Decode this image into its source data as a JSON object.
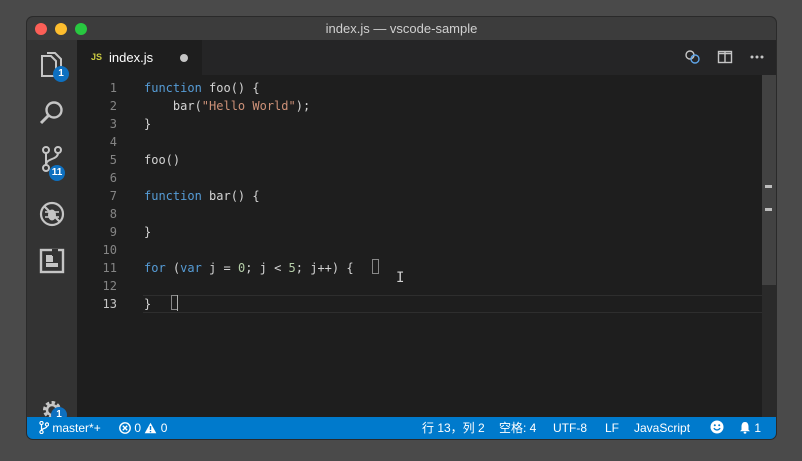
{
  "window": {
    "title": "index.js — vscode-sample"
  },
  "activity_bar": {
    "items": [
      {
        "icon": "files-icon",
        "badge": "1"
      },
      {
        "icon": "search-icon",
        "badge": ""
      },
      {
        "icon": "source-control-icon",
        "badge": "11"
      },
      {
        "icon": "debug-icon",
        "badge": ""
      },
      {
        "icon": "extensions-icon",
        "badge": ""
      }
    ],
    "settings": {
      "icon": "gear-icon",
      "badge": "1"
    }
  },
  "tab": {
    "icon_text": "JS",
    "label": "index.js",
    "dirty": true
  },
  "editor_actions": [
    "open-changes-icon",
    "split-editor-icon",
    "more-actions-icon"
  ],
  "code": {
    "lines": [
      {
        "n": "1",
        "parts": [
          [
            "kw",
            "function"
          ],
          [
            "txt",
            " foo() {"
          ]
        ]
      },
      {
        "n": "2",
        "parts": [
          [
            "txt",
            "    bar("
          ],
          [
            "str",
            "\"Hello World\""
          ],
          [
            "txt",
            ");"
          ]
        ]
      },
      {
        "n": "3",
        "parts": [
          [
            "txt",
            "}"
          ]
        ]
      },
      {
        "n": "4",
        "parts": []
      },
      {
        "n": "5",
        "parts": [
          [
            "txt",
            "foo()"
          ]
        ]
      },
      {
        "n": "6",
        "parts": []
      },
      {
        "n": "7",
        "parts": [
          [
            "kw",
            "function"
          ],
          [
            "txt",
            " bar() {"
          ]
        ]
      },
      {
        "n": "8",
        "parts": []
      },
      {
        "n": "9",
        "parts": [
          [
            "txt",
            "}"
          ]
        ]
      },
      {
        "n": "10",
        "parts": []
      },
      {
        "n": "11",
        "parts": [
          [
            "kw",
            "for"
          ],
          [
            "txt",
            " ("
          ],
          [
            "kw",
            "var"
          ],
          [
            "txt",
            " j = "
          ],
          [
            "num",
            "0"
          ],
          [
            "txt",
            "; j < "
          ],
          [
            "num",
            "5"
          ],
          [
            "txt",
            "; j++) {"
          ]
        ]
      },
      {
        "n": "12",
        "parts": []
      },
      {
        "n": "13",
        "parts": [
          [
            "txt",
            "}"
          ]
        ]
      }
    ],
    "active_line": "13"
  },
  "status_bar": {
    "branch": "master*+",
    "errors": "0",
    "warnings": "0",
    "cursor_position": "行 13，列 2",
    "indentation": "空格: 4",
    "encoding": "UTF-8",
    "eol": "LF",
    "language": "JavaScript",
    "notifications": "1"
  },
  "colors": {
    "status_bar": "#007acc",
    "keyword": "#569cd6",
    "string": "#ce9178",
    "number": "#b5cea8",
    "badge": "#0e70c0"
  }
}
